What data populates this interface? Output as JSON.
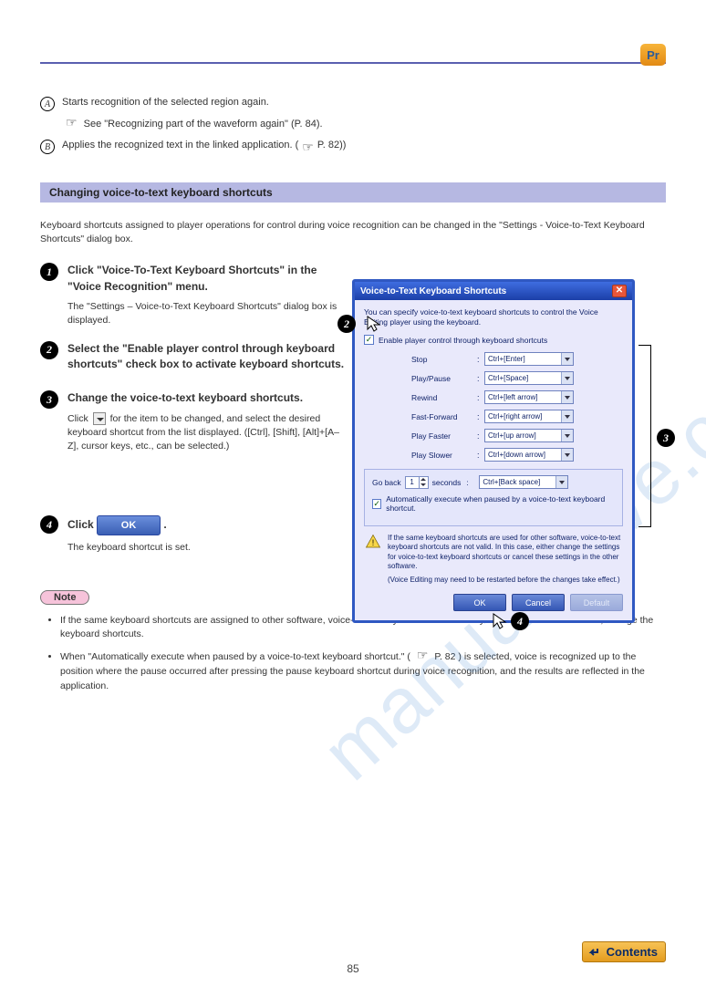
{
  "watermark": "manualshive.com",
  "badge": "Pr",
  "page_number": "85",
  "refs": {
    "a_text": "Starts recognition of the selected region again.",
    "a_link": "See \"Recognizing part of the waveform again\" (P. 84).",
    "b_text": "Applies the recognized text in the linked application. (",
    "b_link": "P. 82)"
  },
  "band_title": "Changing voice-to-text keyboard shortcuts",
  "band_intro": "Keyboard shortcuts assigned to player operations for control during voice recognition can be changed in the \"Settings - Voice-to-Text Keyboard Shortcuts\" dialog box.",
  "steps": {
    "s1": {
      "title": "Click \"Voice-To-Text Keyboard Shortcuts\" in the \"Voice Recognition\" menu.",
      "text": "The \"Settings – Voice-to-Text Keyboard Shortcuts\" dialog box is displayed."
    },
    "s2": {
      "title": "Select the \"Enable player control through keyboard shortcuts\" check box to activate keyboard shortcuts."
    },
    "s3": {
      "title": "Change the voice-to-text keyboard shortcuts.",
      "text_before": "Click ",
      "text_after": " for the item to be changed, and select the desired keyboard shortcut from the list displayed. ([Ctrl], [Shift], [Alt]+[A–Z], cursor keys, etc., can be selected.)"
    },
    "s4": {
      "title_before": "Click ",
      "title_after": ".",
      "text": "The keyboard shortcut is set."
    },
    "ok_label": "OK"
  },
  "note_label": "Note",
  "notes": {
    "n1": "If the same keyboard shortcuts are assigned to other software, voice-to-text keyboard shortcuts may not function. In such cases, change the keyboard shortcuts.",
    "n2_before": "When \"Automatically execute when paused by a voice-to-text keyboard shortcut.\" (",
    "n2_link": "P. 82",
    "n2_after": ") is selected, voice is recognized up to the position where the pause occurred after pressing the pause keyboard shortcut during voice recognition, and the results are reflected in the application."
  },
  "dialog": {
    "title": "Voice-to-Text Keyboard Shortcuts",
    "desc": "You can specify voice-to-text keyboard shortcuts to control the Voice Editing player using the keyboard.",
    "enable_label": "Enable player control through keyboard shortcuts",
    "rows": [
      {
        "label": "Stop",
        "value": "Ctrl+[Enter]"
      },
      {
        "label": "Play/Pause",
        "value": "Ctrl+[Space]"
      },
      {
        "label": "Rewind",
        "value": "Ctrl+[left arrow]"
      },
      {
        "label": "Fast-Forward",
        "value": "Ctrl+[right arrow]"
      },
      {
        "label": "Play Faster",
        "value": "Ctrl+[up arrow]"
      },
      {
        "label": "Play Slower",
        "value": "Ctrl+[down arrow]"
      }
    ],
    "goback_label": "Go back",
    "goback_value": "1",
    "goback_unit": "seconds",
    "goback_shortcut": "Ctrl+[Back space]",
    "auto_label": "Automatically execute when paused by a voice-to-text keyboard shortcut.",
    "warn1": "If the same keyboard shortcuts are used for other software, voice-to-text keyboard shortcuts are not valid. In this case, either change the settings for voice-to-text keyboard shortcuts or cancel these settings in the other software.",
    "warn2": "(Voice Editing may need to be restarted before the changes take effect.)",
    "btn_ok": "OK",
    "btn_cancel": "Cancel",
    "btn_default": "Default"
  },
  "contents_label": "Contents"
}
